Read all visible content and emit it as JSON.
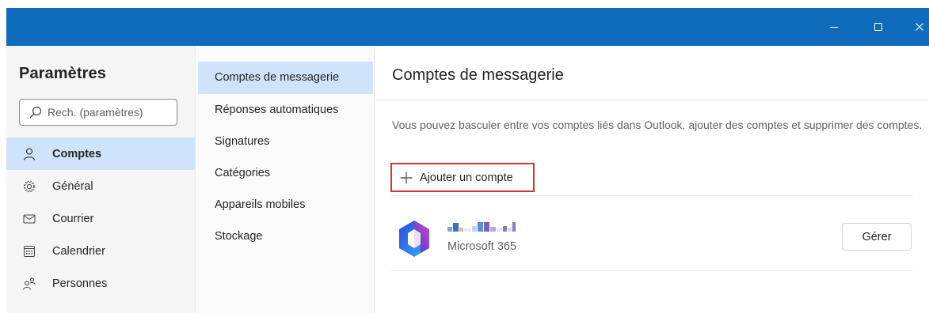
{
  "window": {
    "titlebar_color": "#0f6cbd",
    "controls": [
      "minimize-icon",
      "maximize-icon",
      "close-icon"
    ]
  },
  "settings_nav": {
    "title": "Paramètres",
    "search": {
      "placeholder": "Rech. (paramètres)",
      "value": ""
    },
    "items": [
      {
        "label": "Comptes",
        "icon": "person-icon",
        "active": true
      },
      {
        "label": "Général",
        "icon": "gear-icon",
        "active": false
      },
      {
        "label": "Courrier",
        "icon": "mail-icon",
        "active": false
      },
      {
        "label": "Calendrier",
        "icon": "calendar-icon",
        "active": false
      },
      {
        "label": "Personnes",
        "icon": "people-icon",
        "active": false
      }
    ]
  },
  "subnav": {
    "items": [
      {
        "label": "Comptes de messagerie",
        "active": true
      },
      {
        "label": "Réponses automatiques",
        "active": false
      },
      {
        "label": "Signatures",
        "active": false
      },
      {
        "label": "Catégories",
        "active": false
      },
      {
        "label": "Appareils mobiles",
        "active": false
      },
      {
        "label": "Stockage",
        "active": false
      }
    ]
  },
  "content": {
    "title": "Comptes de messagerie",
    "description": "Vous pouvez basculer entre vos comptes liés dans Outlook, ajouter des comptes et supprimer des comptes.",
    "add_account_label": "Ajouter un compte",
    "accounts": [
      {
        "type": "Microsoft 365",
        "manage_label": "Gérer",
        "icon": "microsoft-365-icon"
      }
    ]
  },
  "colors": {
    "accent": "#0f6cbd",
    "selected_bg": "#cfe4fa",
    "highlight_border": "#d13438"
  }
}
